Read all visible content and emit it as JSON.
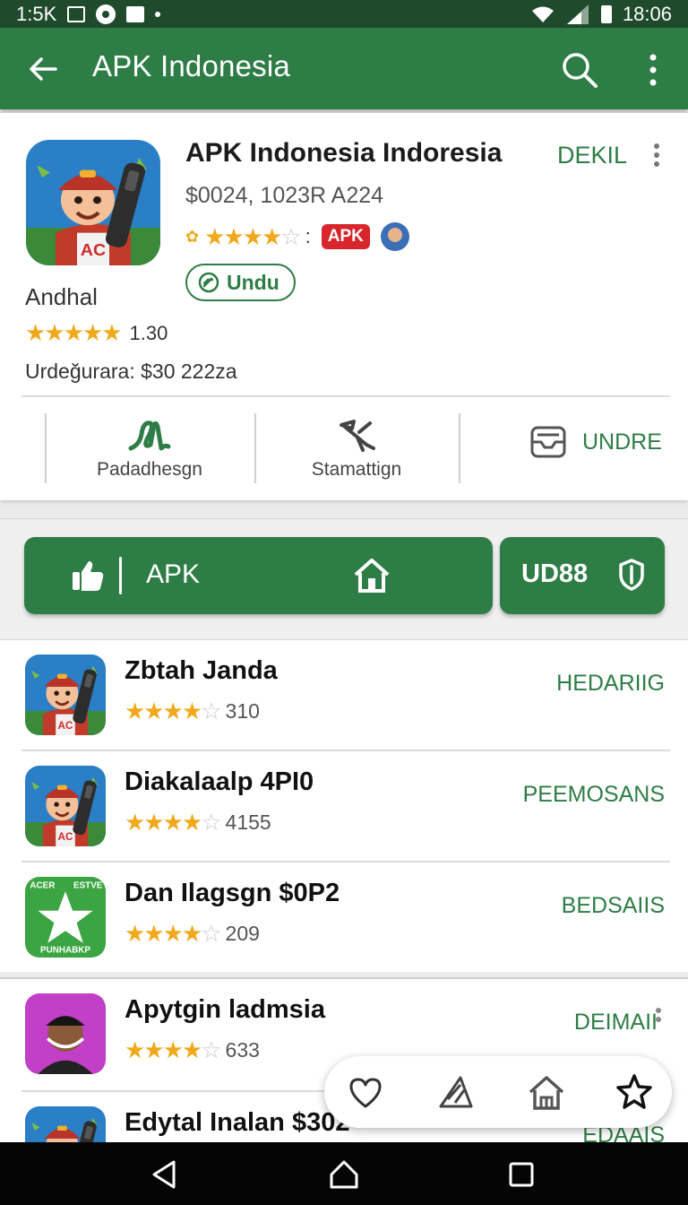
{
  "status_bar": {
    "left_text": "1:5K",
    "time": "18:06"
  },
  "app_bar": {
    "title": "APK Indonesia"
  },
  "detail": {
    "title": "APK Indonesia Indoresia",
    "subtitle": "$0024,  1023R A224",
    "badge": "APK",
    "download_label": "Undu",
    "tag": "DEKIL",
    "label": "Andhal",
    "rating_count": "1.30",
    "upgrade_text": "Urdeğurara: $30 222za",
    "icon_text": "AC",
    "actions": [
      {
        "label": "Padadhesgn"
      },
      {
        "label": "Stamattign"
      },
      {
        "label": "UNDRE"
      }
    ]
  },
  "action_bar": {
    "primary_label": "APK",
    "secondary_label": "UD88"
  },
  "apps": [
    {
      "name": "Zbtah Janda",
      "rating_count": "310",
      "tag": "HEDARIIG",
      "icon": "character-ac"
    },
    {
      "name": "Diakalaalp 4PI0",
      "rating_count": "4155",
      "tag": "PEEMOSANS",
      "icon": "character-ac"
    },
    {
      "name": "Dan Ilagsgn $0P2",
      "rating_count": "209",
      "tag": "BEDSAIIS",
      "icon": "green-star"
    },
    {
      "name": "Apytgin ladmsia",
      "rating_count": "633",
      "tag": "DEIMAII",
      "icon": "person-purple"
    },
    {
      "name": "Edytal Inalan $302",
      "rating_count": "",
      "tag": "EDAAIS",
      "icon": "character-ac"
    }
  ],
  "logo_text": {
    "top_left": "ACER",
    "top_right": "ESTVE",
    "bottom": "PUNHABKP"
  },
  "colors": {
    "primary": "#2e7d46",
    "status_bar": "#1f4a2c",
    "star": "#f0a91c",
    "badge_red": "#d8262c"
  }
}
